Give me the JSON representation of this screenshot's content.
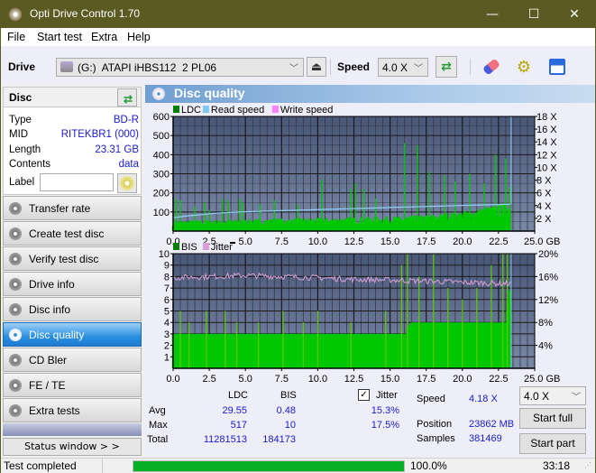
{
  "window": {
    "title": "Opti Drive Control 1.70",
    "minimize": "—",
    "maximize": "☐",
    "close": "✕"
  },
  "menu": [
    "File",
    "Start test",
    "Extra",
    "Help"
  ],
  "toolbar": {
    "drive_label": "Drive",
    "drive_value": "(G:)  ATAPI iHBS112  2 PL06",
    "speed_label": "Speed",
    "speed_value": "4.0 X",
    "icons": [
      "eject-icon",
      "refresh-icon",
      "erase-icon",
      "settings-icon",
      "save-icon"
    ]
  },
  "disc": {
    "header": "Disc",
    "rows": [
      {
        "key": "Type",
        "value": "BD-R"
      },
      {
        "key": "MID",
        "value": "RITEKBR1 (000)"
      },
      {
        "key": "Length",
        "value": "23.31 GB"
      },
      {
        "key": "Contents",
        "value": "data"
      }
    ],
    "label_key": "Label",
    "label_value": ""
  },
  "nav": [
    {
      "label": "Transfer rate",
      "active": false
    },
    {
      "label": "Create test disc",
      "active": false
    },
    {
      "label": "Verify test disc",
      "active": false
    },
    {
      "label": "Drive info",
      "active": false
    },
    {
      "label": "Disc info",
      "active": false
    },
    {
      "label": "Disc quality",
      "active": true
    },
    {
      "label": "CD Bler",
      "active": false
    },
    {
      "label": "FE / TE",
      "active": false
    },
    {
      "label": "Extra tests",
      "active": false
    }
  ],
  "status_window_button": "Status window > >",
  "panel_title": "Disc quality",
  "colors": {
    "ldc": "#00c800",
    "read_speed": "#80c8f0",
    "write_speed": "#ff80ff",
    "bis": "#00c800",
    "jitter": "#d8a0d8",
    "plot_bg": "#4a5878",
    "accent": "#1a1acc"
  },
  "chart_data": [
    {
      "type": "bar",
      "title": "LDC / Read speed",
      "legend": [
        "LDC",
        "Read speed",
        "Write speed"
      ],
      "legend_placement": "top-left",
      "xlabel": "GB",
      "x_ticks": [
        "0.0",
        "2.5",
        "5.0",
        "7.5",
        "10.0",
        "12.5",
        "15.0",
        "17.5",
        "20.0",
        "22.5",
        "25.0 GB"
      ],
      "xlim": [
        0,
        25
      ],
      "y_ticks": [
        "100",
        "200",
        "300",
        "400",
        "500",
        "600"
      ],
      "ylim": [
        0,
        600
      ],
      "y2_ticks": [
        "2 X",
        "4 X",
        "6 X",
        "8 X",
        "10 X",
        "12 X",
        "14 X",
        "16 X",
        "18 X"
      ],
      "y2lim": [
        0,
        18
      ],
      "grid": true,
      "end_gb": 23.31,
      "ldc_baseline": [
        [
          0,
          40
        ],
        [
          5,
          45
        ],
        [
          10,
          50
        ],
        [
          15,
          55
        ],
        [
          17.5,
          60
        ],
        [
          20,
          75
        ],
        [
          22.5,
          100
        ],
        [
          23.3,
          110
        ]
      ],
      "ldc_spikes": [
        [
          0.2,
          170
        ],
        [
          0.5,
          160
        ],
        [
          1.5,
          130
        ],
        [
          2.2,
          150
        ],
        [
          2.5,
          110
        ],
        [
          3.4,
          170
        ],
        [
          3.8,
          160
        ],
        [
          4.6,
          170
        ],
        [
          4.8,
          150
        ],
        [
          6.0,
          140
        ],
        [
          7.0,
          160
        ],
        [
          8.6,
          140
        ],
        [
          10.3,
          270
        ],
        [
          12.3,
          220
        ],
        [
          12.6,
          250
        ],
        [
          13.2,
          220
        ],
        [
          14.0,
          170
        ],
        [
          16.0,
          460
        ],
        [
          16.9,
          450
        ],
        [
          17.7,
          310
        ],
        [
          18.8,
          290
        ],
        [
          19.5,
          260
        ],
        [
          20.5,
          300
        ],
        [
          21.5,
          250
        ],
        [
          22.3,
          400
        ],
        [
          23.0,
          380
        ],
        [
          23.3,
          230
        ]
      ],
      "read_speed": [
        [
          0,
          2.1
        ],
        [
          1,
          2.4
        ],
        [
          2,
          2.6
        ],
        [
          3,
          2.8
        ],
        [
          4.5,
          3.0
        ],
        [
          6,
          3.1
        ],
        [
          7.5,
          3.2
        ],
        [
          9,
          3.3
        ],
        [
          10.5,
          3.4
        ],
        [
          12,
          3.5
        ],
        [
          13.5,
          3.6
        ],
        [
          15,
          3.7
        ],
        [
          16.5,
          3.8
        ],
        [
          18,
          3.9
        ],
        [
          19.5,
          4.0
        ],
        [
          21,
          4.1
        ],
        [
          23.3,
          4.2
        ]
      ],
      "write_speed": []
    },
    {
      "type": "bar",
      "title": "BIS / Jitter",
      "legend": [
        "BIS",
        "Jitter"
      ],
      "legend_placement": "top-left",
      "xlabel": "GB",
      "x_ticks": [
        "0.0",
        "2.5",
        "5.0",
        "7.5",
        "10.0",
        "12.5",
        "15.0",
        "17.5",
        "20.0",
        "22.5",
        "25.0 GB"
      ],
      "xlim": [
        0,
        25
      ],
      "y_ticks": [
        "1",
        "2",
        "3",
        "4",
        "5",
        "6",
        "7",
        "8",
        "9",
        "10"
      ],
      "ylim": [
        0,
        10
      ],
      "y2_ticks": [
        "4%",
        "8%",
        "12%",
        "16%",
        "20%"
      ],
      "y2lim": [
        0,
        20
      ],
      "grid": true,
      "end_gb": 23.31,
      "bis_baseline": [
        [
          0,
          3
        ],
        [
          16,
          3
        ],
        [
          16.5,
          4
        ],
        [
          23,
          4
        ],
        [
          23.3,
          7
        ]
      ],
      "bis_spikes": [
        [
          0.5,
          5
        ],
        [
          1.1,
          4
        ],
        [
          2.3,
          5
        ],
        [
          3.6,
          5
        ],
        [
          4.4,
          4
        ],
        [
          5.9,
          4
        ],
        [
          7.6,
          5
        ],
        [
          9.0,
          4
        ],
        [
          10.0,
          5
        ],
        [
          12.3,
          4
        ],
        [
          14.7,
          5
        ],
        [
          15.8,
          9
        ],
        [
          16.2,
          10
        ],
        [
          17.0,
          8
        ],
        [
          18.0,
          10
        ],
        [
          19.0,
          7
        ],
        [
          20.0,
          6
        ],
        [
          21.0,
          7
        ],
        [
          22.0,
          9
        ],
        [
          22.8,
          10
        ],
        [
          23.1,
          10
        ]
      ],
      "jitter_pct": [
        [
          0,
          15.8
        ],
        [
          2.5,
          16.0
        ],
        [
          5,
          16.2
        ],
        [
          7.5,
          16.0
        ],
        [
          10,
          15.8
        ],
        [
          12.5,
          15.5
        ],
        [
          15,
          15.4
        ],
        [
          17.5,
          15.2
        ],
        [
          20,
          15.0
        ],
        [
          22.5,
          14.8
        ],
        [
          23.3,
          14.8
        ]
      ]
    }
  ],
  "stats": {
    "col_ldc": "LDC",
    "col_bis": "BIS",
    "jitter_label": "Jitter",
    "jitter_checked": true,
    "rows": [
      {
        "label": "Avg",
        "ldc": "29.55",
        "bis": "0.48",
        "jitter": "15.3%"
      },
      {
        "label": "Max",
        "ldc": "517",
        "bis": "10",
        "jitter": "17.5%"
      },
      {
        "label": "Total",
        "ldc": "11281513",
        "bis": "184173",
        "jitter": ""
      }
    ],
    "speed_label": "Speed",
    "speed_value": "4.18 X",
    "position_label": "Position",
    "position_value": "23862 MB",
    "samples_label": "Samples",
    "samples_value": "381469",
    "speed_select": "4.0 X",
    "start_full": "Start full",
    "start_part": "Start part"
  },
  "statusbar": {
    "text": "Test completed",
    "progress": 100.0,
    "progress_text": "100.0%",
    "time": "33:18"
  }
}
